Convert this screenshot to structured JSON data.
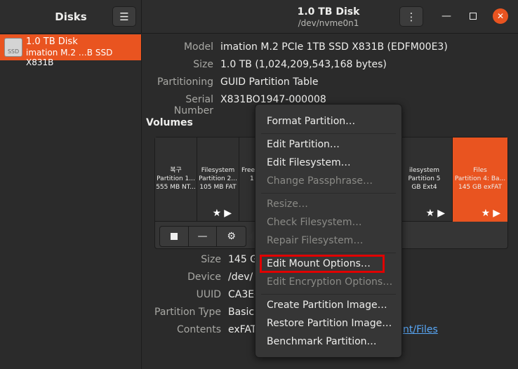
{
  "app": {
    "title": "Disks"
  },
  "window": {
    "title": "1.0 TB Disk",
    "subtitle": "/dev/nvme0n1"
  },
  "sidebar": {
    "disk": {
      "name": "1.0 TB Disk",
      "model": "imation M.2 …B SSD X831B",
      "icon_label": "SSD"
    }
  },
  "disk_info": {
    "model_label": "Model",
    "model": "imation M.2 PCIe 1TB SSD X831B (EDFM00E3)",
    "size_label": "Size",
    "size": "1.0 TB (1,024,209,543,168 bytes)",
    "partitioning_label": "Partitioning",
    "partitioning": "GUID Partition Table",
    "serial_label": "Serial Number",
    "serial": "X831BO1947-000008"
  },
  "volumes": {
    "heading": "Volumes",
    "partitions": [
      {
        "line1": "복구",
        "line2": "Partition 1...",
        "line3": "555 MB NT..."
      },
      {
        "line1": "Filesystem",
        "line2": "Partition 2...",
        "line3": "105 MB FAT"
      },
      {
        "line1": "Free",
        "line2": "1",
        "line3": ""
      },
      {
        "line1": "ilesystem",
        "line2": "Partition 5",
        "line3": "GB Ext4"
      },
      {
        "line1": "Files",
        "line2": "Partition 4: Ba...",
        "line3": "145 GB exFAT"
      }
    ]
  },
  "partition_info": {
    "size_label": "Size",
    "size": "145 G",
    "device_label": "Device",
    "device": "/dev/",
    "uuid_label": "UUID",
    "uuid": "CA3E-",
    "type_label": "Partition Type",
    "type": "Basic",
    "contents_label": "Contents",
    "contents": "exFAT",
    "contents_link": "nt/Files"
  },
  "menu": {
    "format_partition": "Format Partition…",
    "edit_partition": "Edit Partition…",
    "edit_filesystem": "Edit Filesystem…",
    "change_passphrase": "Change Passphrase…",
    "resize": "Resize…",
    "check_filesystem": "Check Filesystem…",
    "repair_filesystem": "Repair Filesystem…",
    "edit_mount_options": "Edit Mount Options…",
    "edit_encryption_options": "Edit Encryption Options…",
    "create_partition_image": "Create Partition Image…",
    "restore_partition_image": "Restore Partition Image…",
    "benchmark_partition": "Benchmark Partition…"
  },
  "icons": {
    "menu": "hamburger-icon",
    "kebab": "vertical-dots-icon",
    "star": "star-icon",
    "play": "play-icon",
    "stop": "stop-icon",
    "minus": "minus-icon",
    "gears": "gears-icon"
  },
  "colors": {
    "accent": "#e95420",
    "highlight_box": "#e00000",
    "link": "#58a8f8"
  }
}
